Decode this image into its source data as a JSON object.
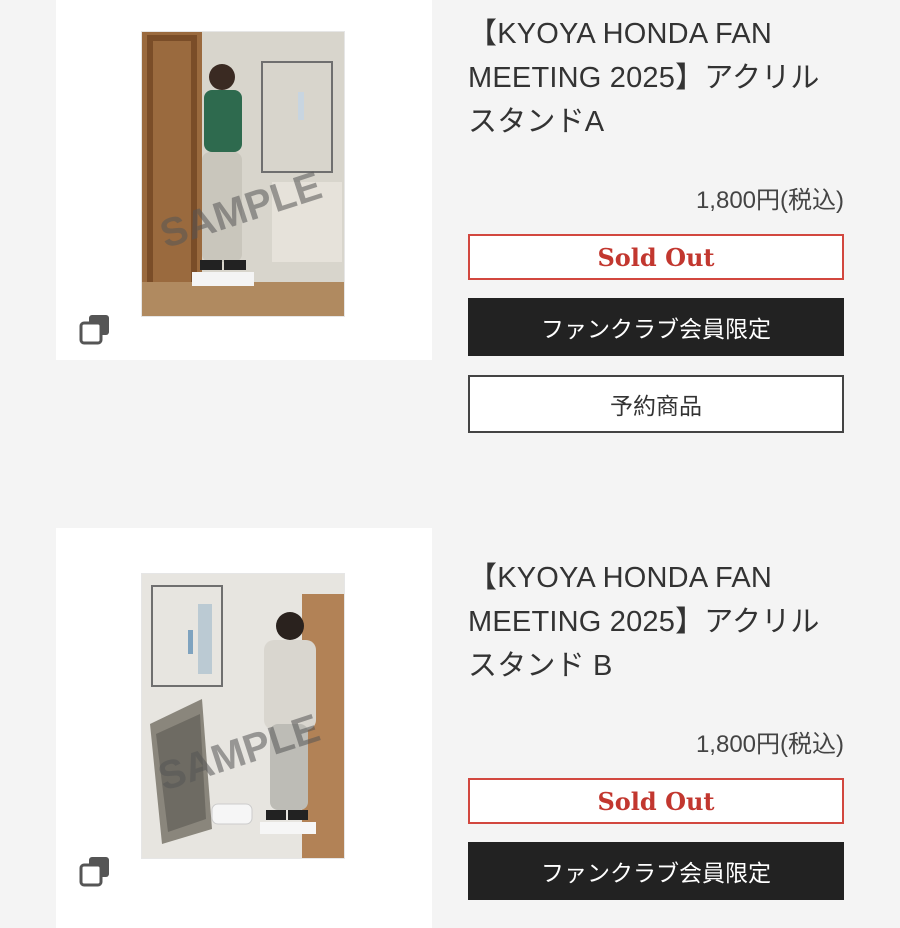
{
  "products": [
    {
      "title_line1": "【KYOYA HONDA FAN",
      "title_line2": "MEETING 2025】アクリル",
      "title_line3": "スタンドA",
      "price": "1,800円(税込)",
      "sold_out_label": "Sold Out",
      "member_label": "ファンクラブ会員限定",
      "reserve_label": "予約商品",
      "image_watermark": "SAMPLE"
    },
    {
      "title_line1": "【KYOYA HONDA FAN",
      "title_line2": "MEETING 2025】アクリル",
      "title_line3": "スタンド B",
      "price": "1,800円(税込)",
      "sold_out_label": "Sold Out",
      "member_label": "ファンクラブ会員限定",
      "image_watermark": "SAMPLE"
    }
  ],
  "colors": {
    "page_bg": "#f4f4f4",
    "sold_out_red": "#c2372f",
    "member_button_bg": "#222222"
  },
  "icons": {
    "gallery": "gallery-stack-icon"
  }
}
